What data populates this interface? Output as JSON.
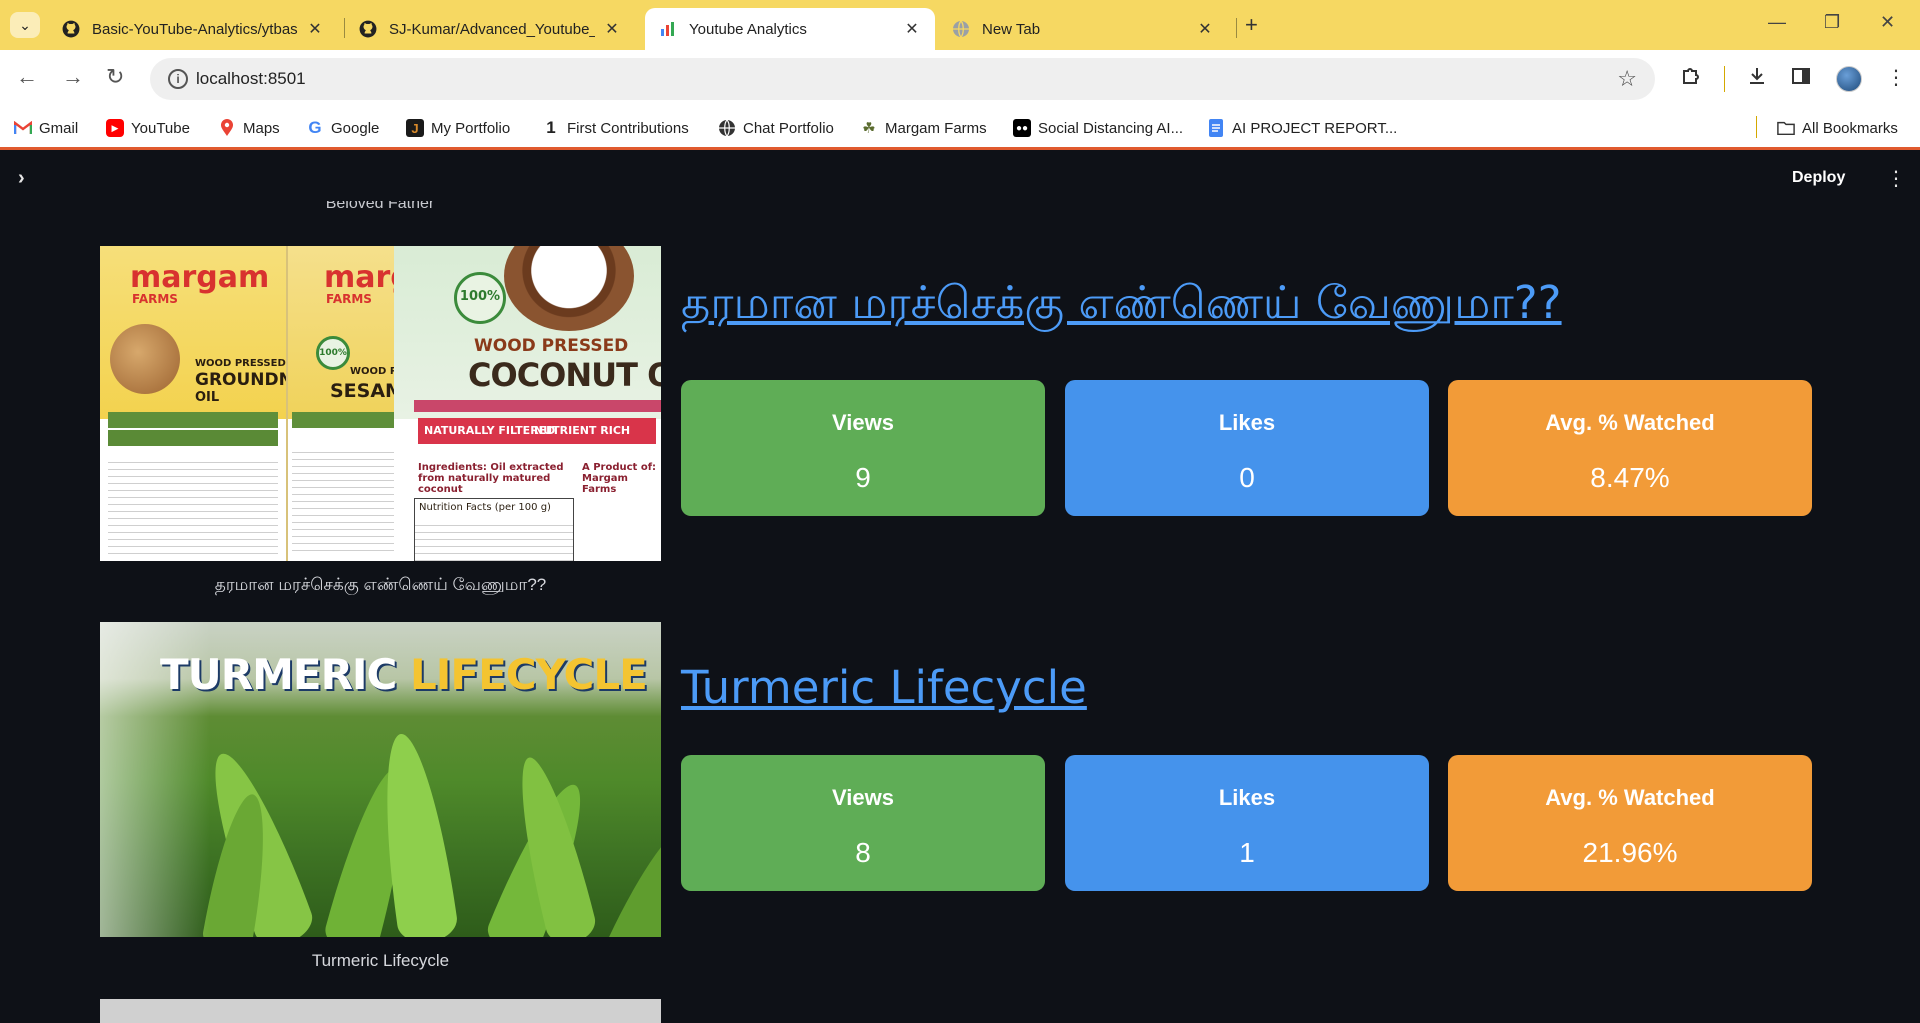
{
  "browser": {
    "tabs": [
      {
        "title": "Basic-YouTube-Analytics/ytbasi",
        "icon": "github-icon",
        "active": false
      },
      {
        "title": "SJ-Kumar/Advanced_Youtube_A",
        "icon": "github-icon",
        "active": false
      },
      {
        "title": "Youtube Analytics",
        "icon": "chart-icon",
        "active": true
      },
      {
        "title": "New Tab",
        "icon": "globe-icon",
        "active": false
      }
    ],
    "url": "localhost:8501",
    "bookmarks": [
      {
        "label": "Gmail",
        "icon": "gmail-icon",
        "color": "#ea4335"
      },
      {
        "label": "YouTube",
        "icon": "youtube-icon",
        "color": "#ff0000"
      },
      {
        "label": "Maps",
        "icon": "maps-icon",
        "color": "#34a853"
      },
      {
        "label": "Google",
        "icon": "google-icon",
        "color": "#4285f4"
      },
      {
        "label": "My Portfolio",
        "icon": "portfolio-icon",
        "color": "#222222"
      },
      {
        "label": "First Contributions",
        "icon": "first-contributions-icon",
        "color": "#222222"
      },
      {
        "label": "Chat Portfolio",
        "icon": "globe-icon",
        "color": "#222222"
      },
      {
        "label": "Margam Farms",
        "icon": "margam-icon",
        "color": "#5a6b2e"
      },
      {
        "label": "Social Distancing AI...",
        "icon": "medium-icon",
        "color": "#000000"
      },
      {
        "label": "AI PROJECT REPORT...",
        "icon": "docs-icon",
        "color": "#4285f4"
      }
    ],
    "all_bookmarks": "All Bookmarks"
  },
  "app": {
    "deploy_label": "Deploy",
    "partial_caption": "Beloved Father",
    "videos": [
      {
        "title": "தரமான மரச்செக்கு எண்ணெய் வேணுமா??",
        "caption": "தரமான மரச்செக்கு எண்ணெய் வேணுமா??",
        "thumbnail": {
          "brand": "margam",
          "farms": "FARMS",
          "p1": "WOOD PRESSED",
          "p1b": "GROUNDNUT",
          "p1c": "OIL",
          "p2": "WOOD PRE",
          "p2b": "SESAM",
          "p3": "WOOD PRESSED",
          "p3b": "COCONUT OIL",
          "badge": "100%",
          "tag1": "NATURALLY FILTERED",
          "tag2": "NUTRIENT RICH",
          "ingredients": "Ingredients: Oil extracted from naturally matured coconut",
          "nutrition": "Nutrition Facts (per 100 g)",
          "producer": "A Product of: Margam Farms"
        },
        "metrics": [
          {
            "label": "Views",
            "value": "9",
            "color": "#5fad56"
          },
          {
            "label": "Likes",
            "value": "0",
            "color": "#4593ec"
          },
          {
            "label": "Avg. % Watched",
            "value": "8.47%",
            "color": "#f29b38"
          }
        ]
      },
      {
        "title": "Turmeric Lifecycle",
        "caption": "Turmeric Lifecycle",
        "thumbnail": {
          "word1": "TURMERIC",
          "word2": "LIFECYCLE"
        },
        "metrics": [
          {
            "label": "Views",
            "value": "8",
            "color": "#5fad56"
          },
          {
            "label": "Likes",
            "value": "1",
            "color": "#4593ec"
          },
          {
            "label": "Avg. % Watched",
            "value": "21.96%",
            "color": "#f29b38"
          }
        ]
      }
    ]
  }
}
